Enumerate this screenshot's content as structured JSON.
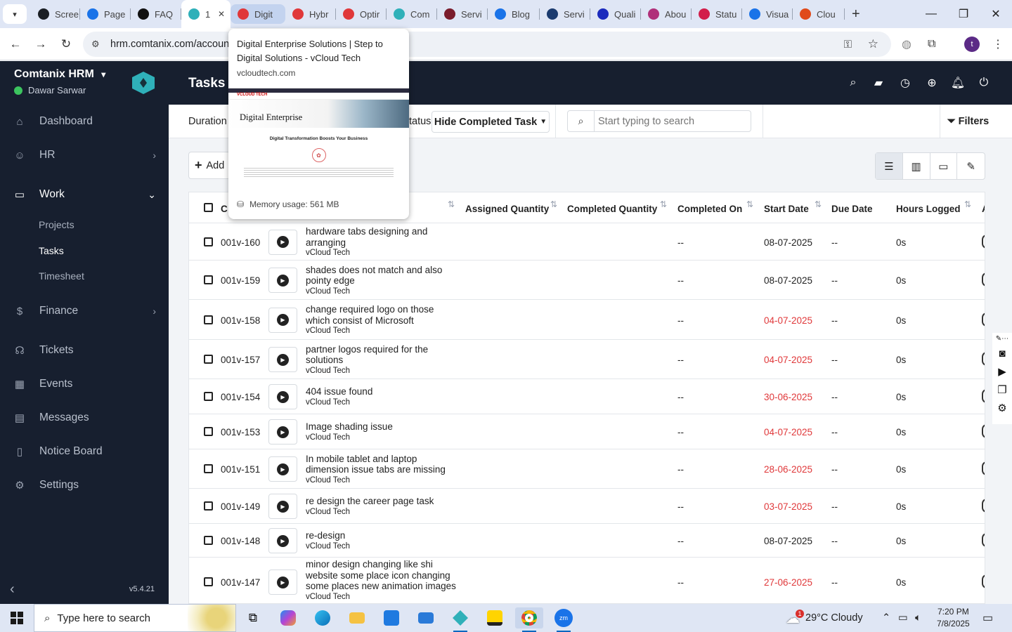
{
  "browser": {
    "tabs": [
      {
        "label": "Scree",
        "icon": "github-icon",
        "color": "#1b1f24"
      },
      {
        "label": "Page",
        "icon": "speed-icon",
        "color": "#1a73e8"
      },
      {
        "label": "FAQ",
        "icon": "openai-icon",
        "color": "#111111"
      },
      {
        "label": "1",
        "icon": "comtanix-icon",
        "color": "#2fb0b9"
      },
      {
        "label": "Digit",
        "icon": "vcloud-icon",
        "color": "#e0383a"
      },
      {
        "label": "Hybr",
        "icon": "vcloud-icon",
        "color": "#e0383a"
      },
      {
        "label": "Optir",
        "icon": "vcloud-icon",
        "color": "#e0383a"
      },
      {
        "label": "Com",
        "icon": "comtanix-icon",
        "color": "#2fb0b9"
      },
      {
        "label": "Servi",
        "icon": "check-v-icon",
        "color": "#7a1c2c"
      },
      {
        "label": "Blog",
        "icon": "blog-icon",
        "color": "#1a73e8"
      },
      {
        "label": "Servi",
        "icon": "check-v-icon",
        "color": "#1b3b6f"
      },
      {
        "label": "Quali",
        "icon": "x-icon",
        "color": "#1b2bbd"
      },
      {
        "label": "Abou",
        "icon": "aboutus-icon",
        "color": "#b0307a"
      },
      {
        "label": "Statu",
        "icon": "status-icon",
        "color": "#d21e4a"
      },
      {
        "label": "Visua",
        "icon": "visual-icon",
        "color": "#1a73e8"
      },
      {
        "label": "Clou",
        "icon": "cloud-icon",
        "color": "#e04a1a"
      }
    ],
    "url": "hrm.comtanix.com/account",
    "tooltip": {
      "title": "Digital Enterprise Solutions | Step to Digital Solutions - vCloud Tech",
      "domain": "vcloudtech.com",
      "memory": "Memory usage: 561 MB",
      "thumb_logo": "VCLOUD TECH",
      "thumb_heading": "Digital Enterprise",
      "thumb_sub": "Digital Transformation Boosts Your Business"
    }
  },
  "sidebar": {
    "brand": "Comtanix HRM",
    "user": "Dawar Sarwar",
    "items": [
      {
        "label": "Dashboard",
        "icon": "home-icon"
      },
      {
        "label": "HR",
        "icon": "users-icon"
      },
      {
        "label": "Work",
        "icon": "briefcase-icon"
      },
      {
        "label": "Finance",
        "icon": "dollar-icon"
      },
      {
        "label": "Tickets",
        "icon": "headset-icon"
      },
      {
        "label": "Events",
        "icon": "calendar-icon"
      },
      {
        "label": "Messages",
        "icon": "message-icon"
      },
      {
        "label": "Notice Board",
        "icon": "clipboard-icon"
      },
      {
        "label": "Settings",
        "icon": "gear-icon"
      }
    ],
    "work_sub": [
      "Projects",
      "Tasks",
      "Timesheet"
    ],
    "version": "v5.4.21"
  },
  "header": {
    "title": "Tasks"
  },
  "filters": {
    "duration_label": "Duration",
    "status_label": "tatus",
    "hide_completed": "Hide Completed Task",
    "search_placeholder": "Start typing to search",
    "filters_label": "Filters",
    "add_label": "Add"
  },
  "table": {
    "columns": [
      "C",
      "Assigned Quantity",
      "Completed Quantity",
      "Completed On",
      "Start Date",
      "Due Date",
      "Hours Logged",
      "A"
    ],
    "rows": [
      {
        "code": "001v-160",
        "task": "hardware tabs designing and arranging",
        "project": "vCloud Tech",
        "completed_on": "--",
        "start": "08-07-2025",
        "late": false,
        "due": "--",
        "hours": "0s"
      },
      {
        "code": "001v-159",
        "task": "shades does not match and also pointy edge",
        "project": "vCloud Tech",
        "completed_on": "--",
        "start": "08-07-2025",
        "late": false,
        "due": "--",
        "hours": "0s"
      },
      {
        "code": "001v-158",
        "task": "change required logo on those which consist of Microsoft",
        "project": "vCloud Tech",
        "completed_on": "--",
        "start": "04-07-2025",
        "late": true,
        "due": "--",
        "hours": "0s"
      },
      {
        "code": "001v-157",
        "task": "partner logos required for the solutions",
        "project": "vCloud Tech",
        "completed_on": "--",
        "start": "04-07-2025",
        "late": true,
        "due": "--",
        "hours": "0s"
      },
      {
        "code": "001v-154",
        "task": "404 issue found",
        "project": "vCloud Tech",
        "completed_on": "--",
        "start": "30-06-2025",
        "late": true,
        "due": "--",
        "hours": "0s"
      },
      {
        "code": "001v-153",
        "task": "Image shading issue",
        "project": "vCloud Tech",
        "completed_on": "--",
        "start": "04-07-2025",
        "late": true,
        "due": "--",
        "hours": "0s"
      },
      {
        "code": "001v-151",
        "task": "In mobile tablet and laptop dimension issue tabs are missing",
        "project": "vCloud Tech",
        "completed_on": "--",
        "start": "28-06-2025",
        "late": true,
        "due": "--",
        "hours": "0s"
      },
      {
        "code": "001v-149",
        "task": "re design the career page task",
        "project": "vCloud Tech",
        "completed_on": "--",
        "start": "03-07-2025",
        "late": true,
        "due": "--",
        "hours": "0s"
      },
      {
        "code": "001v-148",
        "task": "re-design",
        "project": "vCloud Tech",
        "completed_on": "--",
        "start": "08-07-2025",
        "late": false,
        "due": "--",
        "hours": "0s"
      },
      {
        "code": "001v-147",
        "task": "minor design changing like shi website some place icon changing some places new animation images",
        "project": "vCloud Tech",
        "completed_on": "--",
        "start": "27-06-2025",
        "late": true,
        "due": "--",
        "hours": "0s"
      }
    ]
  },
  "taskbar": {
    "search_placeholder": "Type here to search",
    "weather": "29°C  Cloudy",
    "weather_badge": "1",
    "time": "7:20 PM",
    "date": "7/8/2025"
  },
  "colors": {
    "sidebar_bg": "#171f2f",
    "accent": "#2fb0b9",
    "late": "#e0383a"
  }
}
